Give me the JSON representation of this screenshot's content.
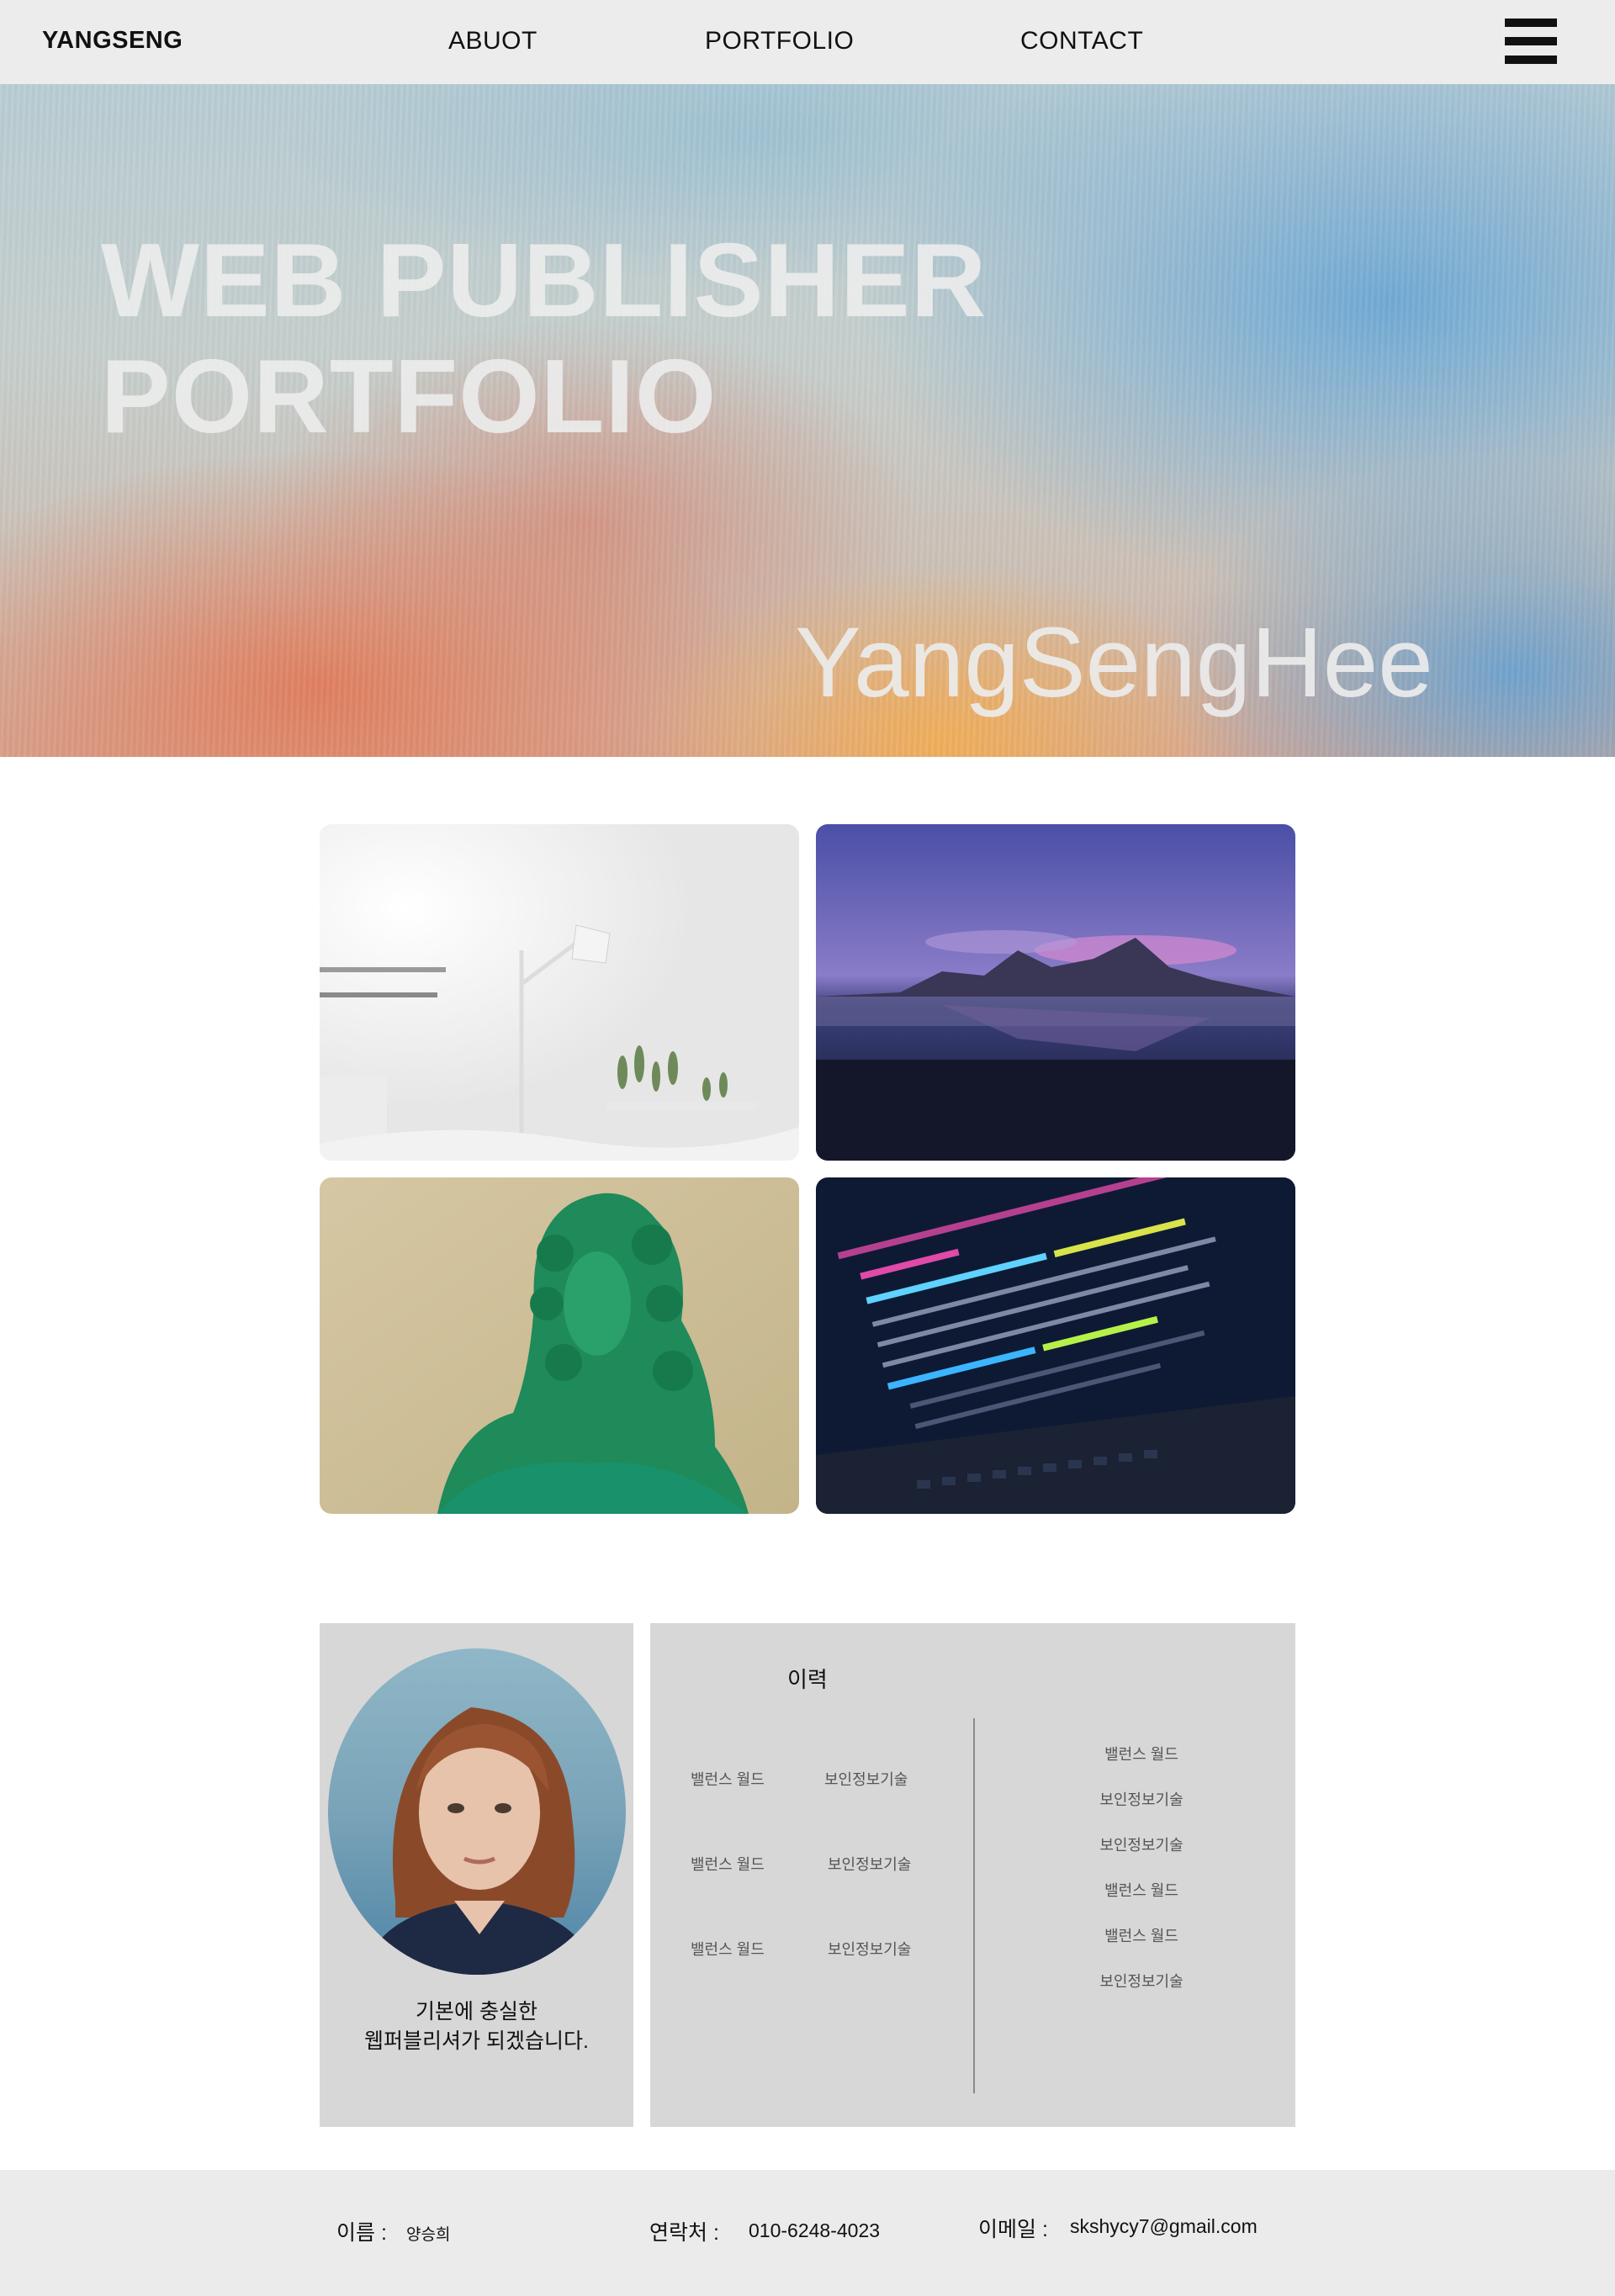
{
  "header": {
    "logo": "YANGSENG",
    "nav": [
      "ABUOT",
      "PORTFOLIO",
      "CONTACT"
    ],
    "menu_icon": "hamburger-menu-icon"
  },
  "hero": {
    "title_line1": "WEB PUBLISHER",
    "title_line2": "PORTFOLIO",
    "name": "YangSengHee"
  },
  "gallery": {
    "images": [
      "white room with lamp and plants",
      "mountain reflecting on beach at dusk",
      "green statue bust",
      "code on laptop screen"
    ]
  },
  "profile": {
    "line1": "기본에 충실한",
    "line2": "웹퍼블리셔가 되겠습니다."
  },
  "history": {
    "title": "이력",
    "left_rows": [
      [
        "밸런스 월드",
        "보인정보기술"
      ],
      [
        "밸런스 월드",
        "보인정보기술"
      ],
      [
        "밸런스 월드",
        "보인정보기술"
      ]
    ],
    "right_items": [
      "밸런스 월드",
      "보인정보기술",
      "보인정보기술",
      "밸런스 월드",
      "밸런스 월드",
      "보인정보기술"
    ]
  },
  "footer": {
    "name_label": "이름 :",
    "name_value": "양승희",
    "phone_label": "연락처 :",
    "phone_value": "010-6248-4023",
    "email_label": "이메일 :",
    "email_value": "skshycy7@gmail.com"
  }
}
